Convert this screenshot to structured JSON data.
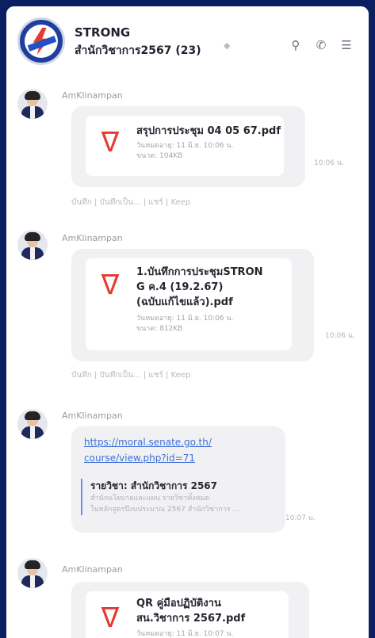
{
  "header": {
    "group_name": "STRONG",
    "group_sub": "สำนักวิชาการ2567 (23)",
    "mute_icon": "bell-off-icon",
    "icons": [
      "search-icon",
      "phone-icon",
      "menu-icon"
    ]
  },
  "messages": [
    {
      "sender": "AmKlinampan",
      "file_name": "สรุปการประชุม 04 05 67.pdf",
      "file_meta_1": "วันหมดอายุ: 11 มิ.ย. 10:06 น.",
      "file_meta_2": "ขนาด: 104KB",
      "time": "10:06 น.",
      "actions": "บันทึก | บันทึกเป็น... | แชร์ | Keep"
    },
    {
      "sender": "AmKlinampan",
      "file_name_lines": [
        "1.บันทึกการประชุมSTRON",
        "G ค.4 (19.2.67)",
        "(ฉบับแก้ไขแล้ว).pdf"
      ],
      "file_meta_1": "วันหมดอายุ: 11 มิ.ย. 10:06 น.",
      "file_meta_2": "ขนาด: 812KB",
      "time": "10:06 น.",
      "actions": "บันทึก | บันทึกเป็น... | แชร์ | Keep"
    },
    {
      "sender": "AmKlinampan",
      "link_lines": [
        "https://moral.senate.go.th/",
        "course/view.php?id=71"
      ],
      "preview_title": "รายวิชา: สำนักวิชาการ 2567",
      "preview_desc_1": "สำนักนโยบายและแผน รายวิชาทั้งหมด",
      "preview_desc_2": "ในหลักสูตรปีงบประมาณ 2567 สำนักวิชาการ ...",
      "time": "10:07 น."
    },
    {
      "sender": "AmKlinampan",
      "file_name_lines": [
        "QR คู่มือปฏิบัติงาน",
        "สน.วิชาการ 2567.pdf"
      ],
      "file_meta_1": "วันหมดอายุ: 11 มิ.ย. 10:07 น."
    }
  ]
}
